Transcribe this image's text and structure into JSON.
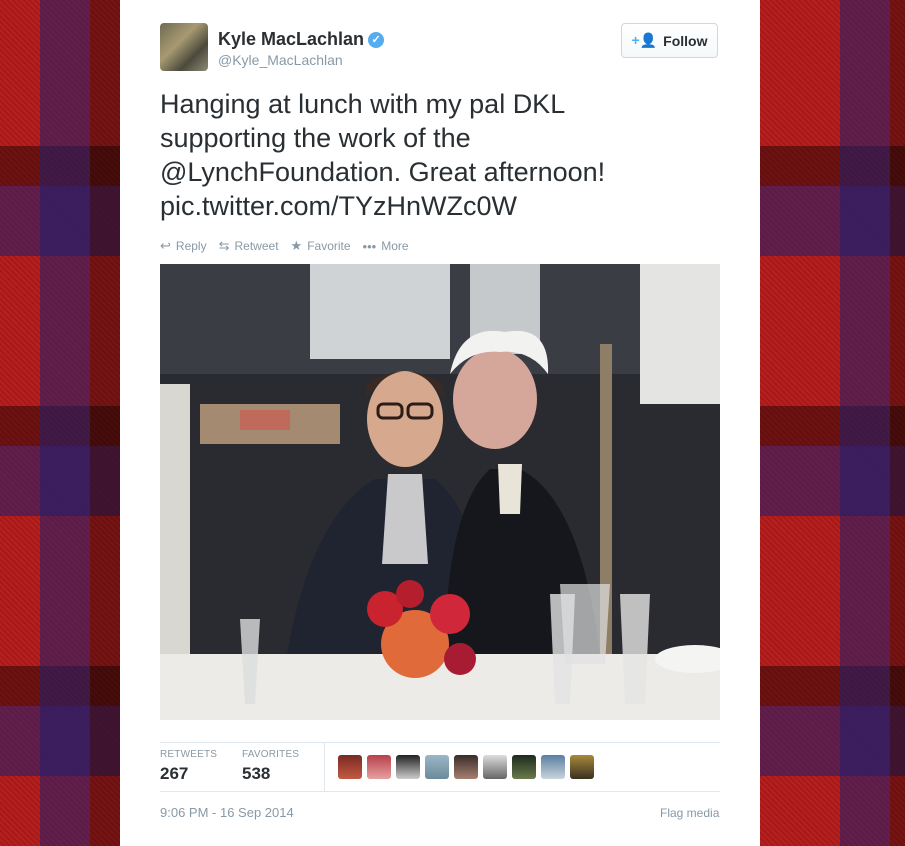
{
  "tweet": {
    "name": "Kyle MacLachlan",
    "handle": "@Kyle_MacLachlan",
    "follow_label": "Follow",
    "text_line1": "Hanging at lunch with my pal DKL",
    "text_line2": "supporting the work of the",
    "mention": "@LynchFoundation",
    "text_line3_rest": ". Great afternoon!",
    "link": "pic.twitter.com/TYzHnWZc0W",
    "actions": {
      "reply": "Reply",
      "retweet": "Retweet",
      "favorite": "Favorite",
      "more": "More"
    },
    "stats": {
      "retweets_label": "RETWEETS",
      "retweets_value": "267",
      "favorites_label": "FAVORITES",
      "favorites_value": "538"
    },
    "timestamp": "9:06 PM - 16 Sep 2014",
    "flag_label": "Flag media"
  },
  "colors": {
    "verified": "#55acee",
    "text": "#292f33",
    "muted": "#8899a6"
  },
  "icons": [
    "verified-badge-icon",
    "follow-user-plus-icon",
    "reply-icon",
    "retweet-icon",
    "favorite-star-icon",
    "more-dots-icon"
  ]
}
